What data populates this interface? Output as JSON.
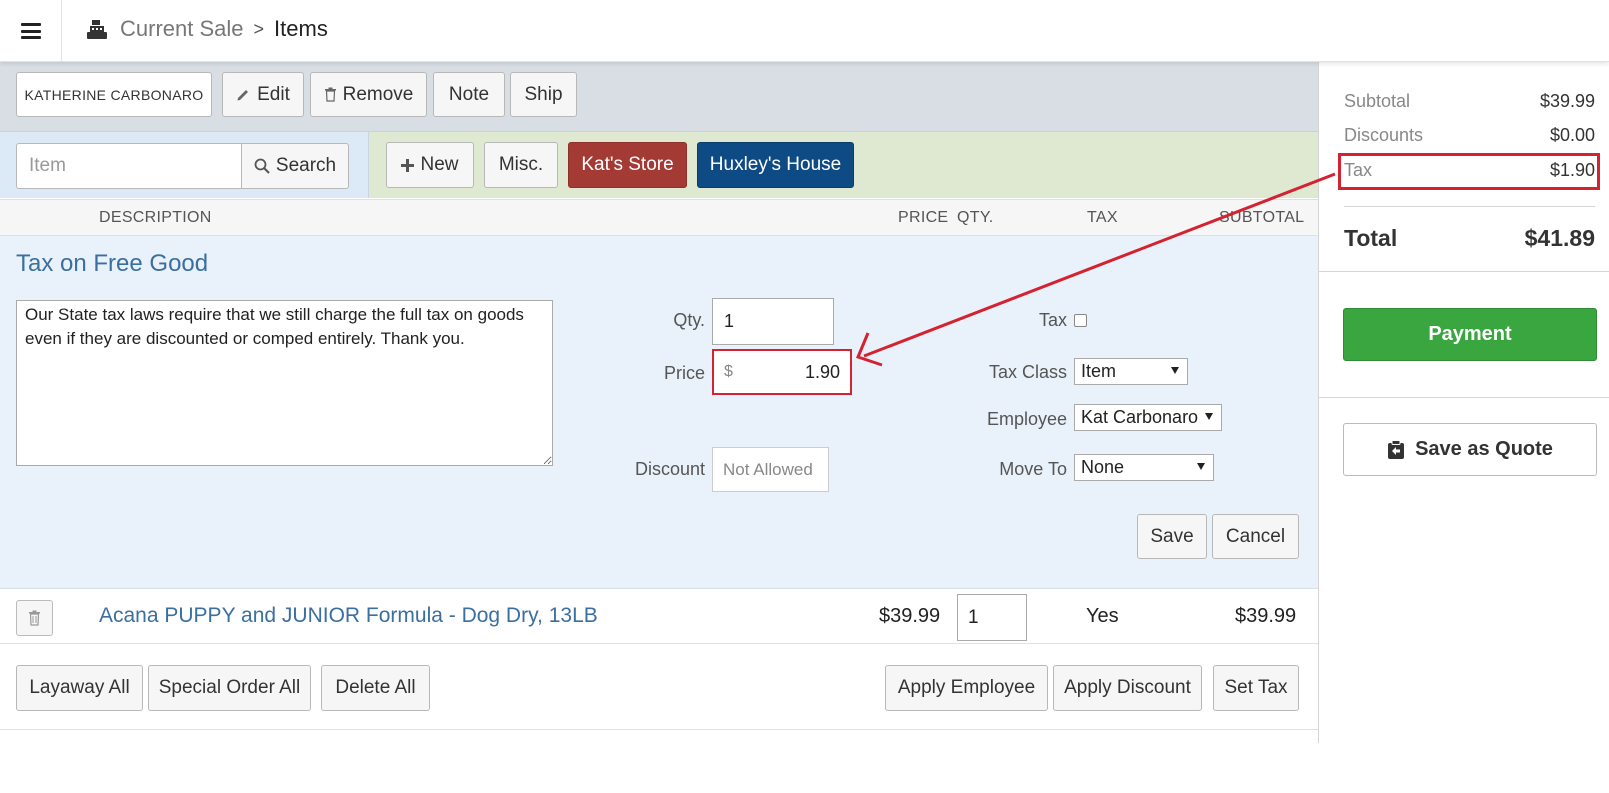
{
  "header": {
    "breadcrumb_current_sale": "Current Sale",
    "breadcrumb_separator": ">",
    "breadcrumb_items": "Items"
  },
  "customer_bar": {
    "customer_name": "KATHERINE CARBONARO",
    "edit_label": "Edit",
    "remove_label": "Remove",
    "note_label": "Note",
    "ship_label": "Ship"
  },
  "search_bar": {
    "item_placeholder": "Item",
    "search_label": "Search",
    "new_label": "New",
    "misc_label": "Misc.",
    "shortcut_1": "Kat's Store",
    "shortcut_2": "Huxley's House",
    "shortcut_1_color": "#a33a34",
    "shortcut_2_color": "#0e4a83"
  },
  "columns": {
    "description": "DESCRIPTION",
    "price": "PRICE",
    "qty": "QTY.",
    "tax": "TAX",
    "subtotal": "SUBTOTAL"
  },
  "editor": {
    "title": "Tax on Free Good",
    "note_text": "Our State tax laws require that we still charge the full tax on goods even if they are discounted or comped entirely. Thank you.",
    "qty_label": "Qty.",
    "qty_value": "1",
    "price_label": "Price",
    "price_currency": "$",
    "price_value": "1.90",
    "discount_label": "Discount",
    "discount_value": "Not Allowed",
    "tax_label": "Tax",
    "tax_checked": false,
    "tax_class_label": "Tax Class",
    "tax_class_value": "Item",
    "employee_label": "Employee",
    "employee_value": "Kat Carbonaro",
    "move_to_label": "Move To",
    "move_to_value": "None",
    "save_label": "Save",
    "cancel_label": "Cancel"
  },
  "line_item": {
    "description": "Acana PUPPY and JUNIOR Formula - Dog Dry, 13LB",
    "price": "$39.99",
    "qty": "1",
    "tax": "Yes",
    "subtotal": "$39.99"
  },
  "bottom_actions": {
    "layaway_all": "Layaway All",
    "special_order_all": "Special Order All",
    "delete_all": "Delete All",
    "apply_employee": "Apply Employee",
    "apply_discount": "Apply Discount",
    "set_tax": "Set Tax"
  },
  "summary": {
    "subtotal_label": "Subtotal",
    "subtotal_value": "$39.99",
    "discounts_label": "Discounts",
    "discounts_value": "$0.00",
    "tax_label": "Tax",
    "tax_value": "$1.90",
    "total_label": "Total",
    "total_value": "$41.89",
    "payment_label": "Payment",
    "quote_label": "Save as Quote",
    "payment_color": "#3aa640",
    "highlight_color": "#d42230"
  }
}
